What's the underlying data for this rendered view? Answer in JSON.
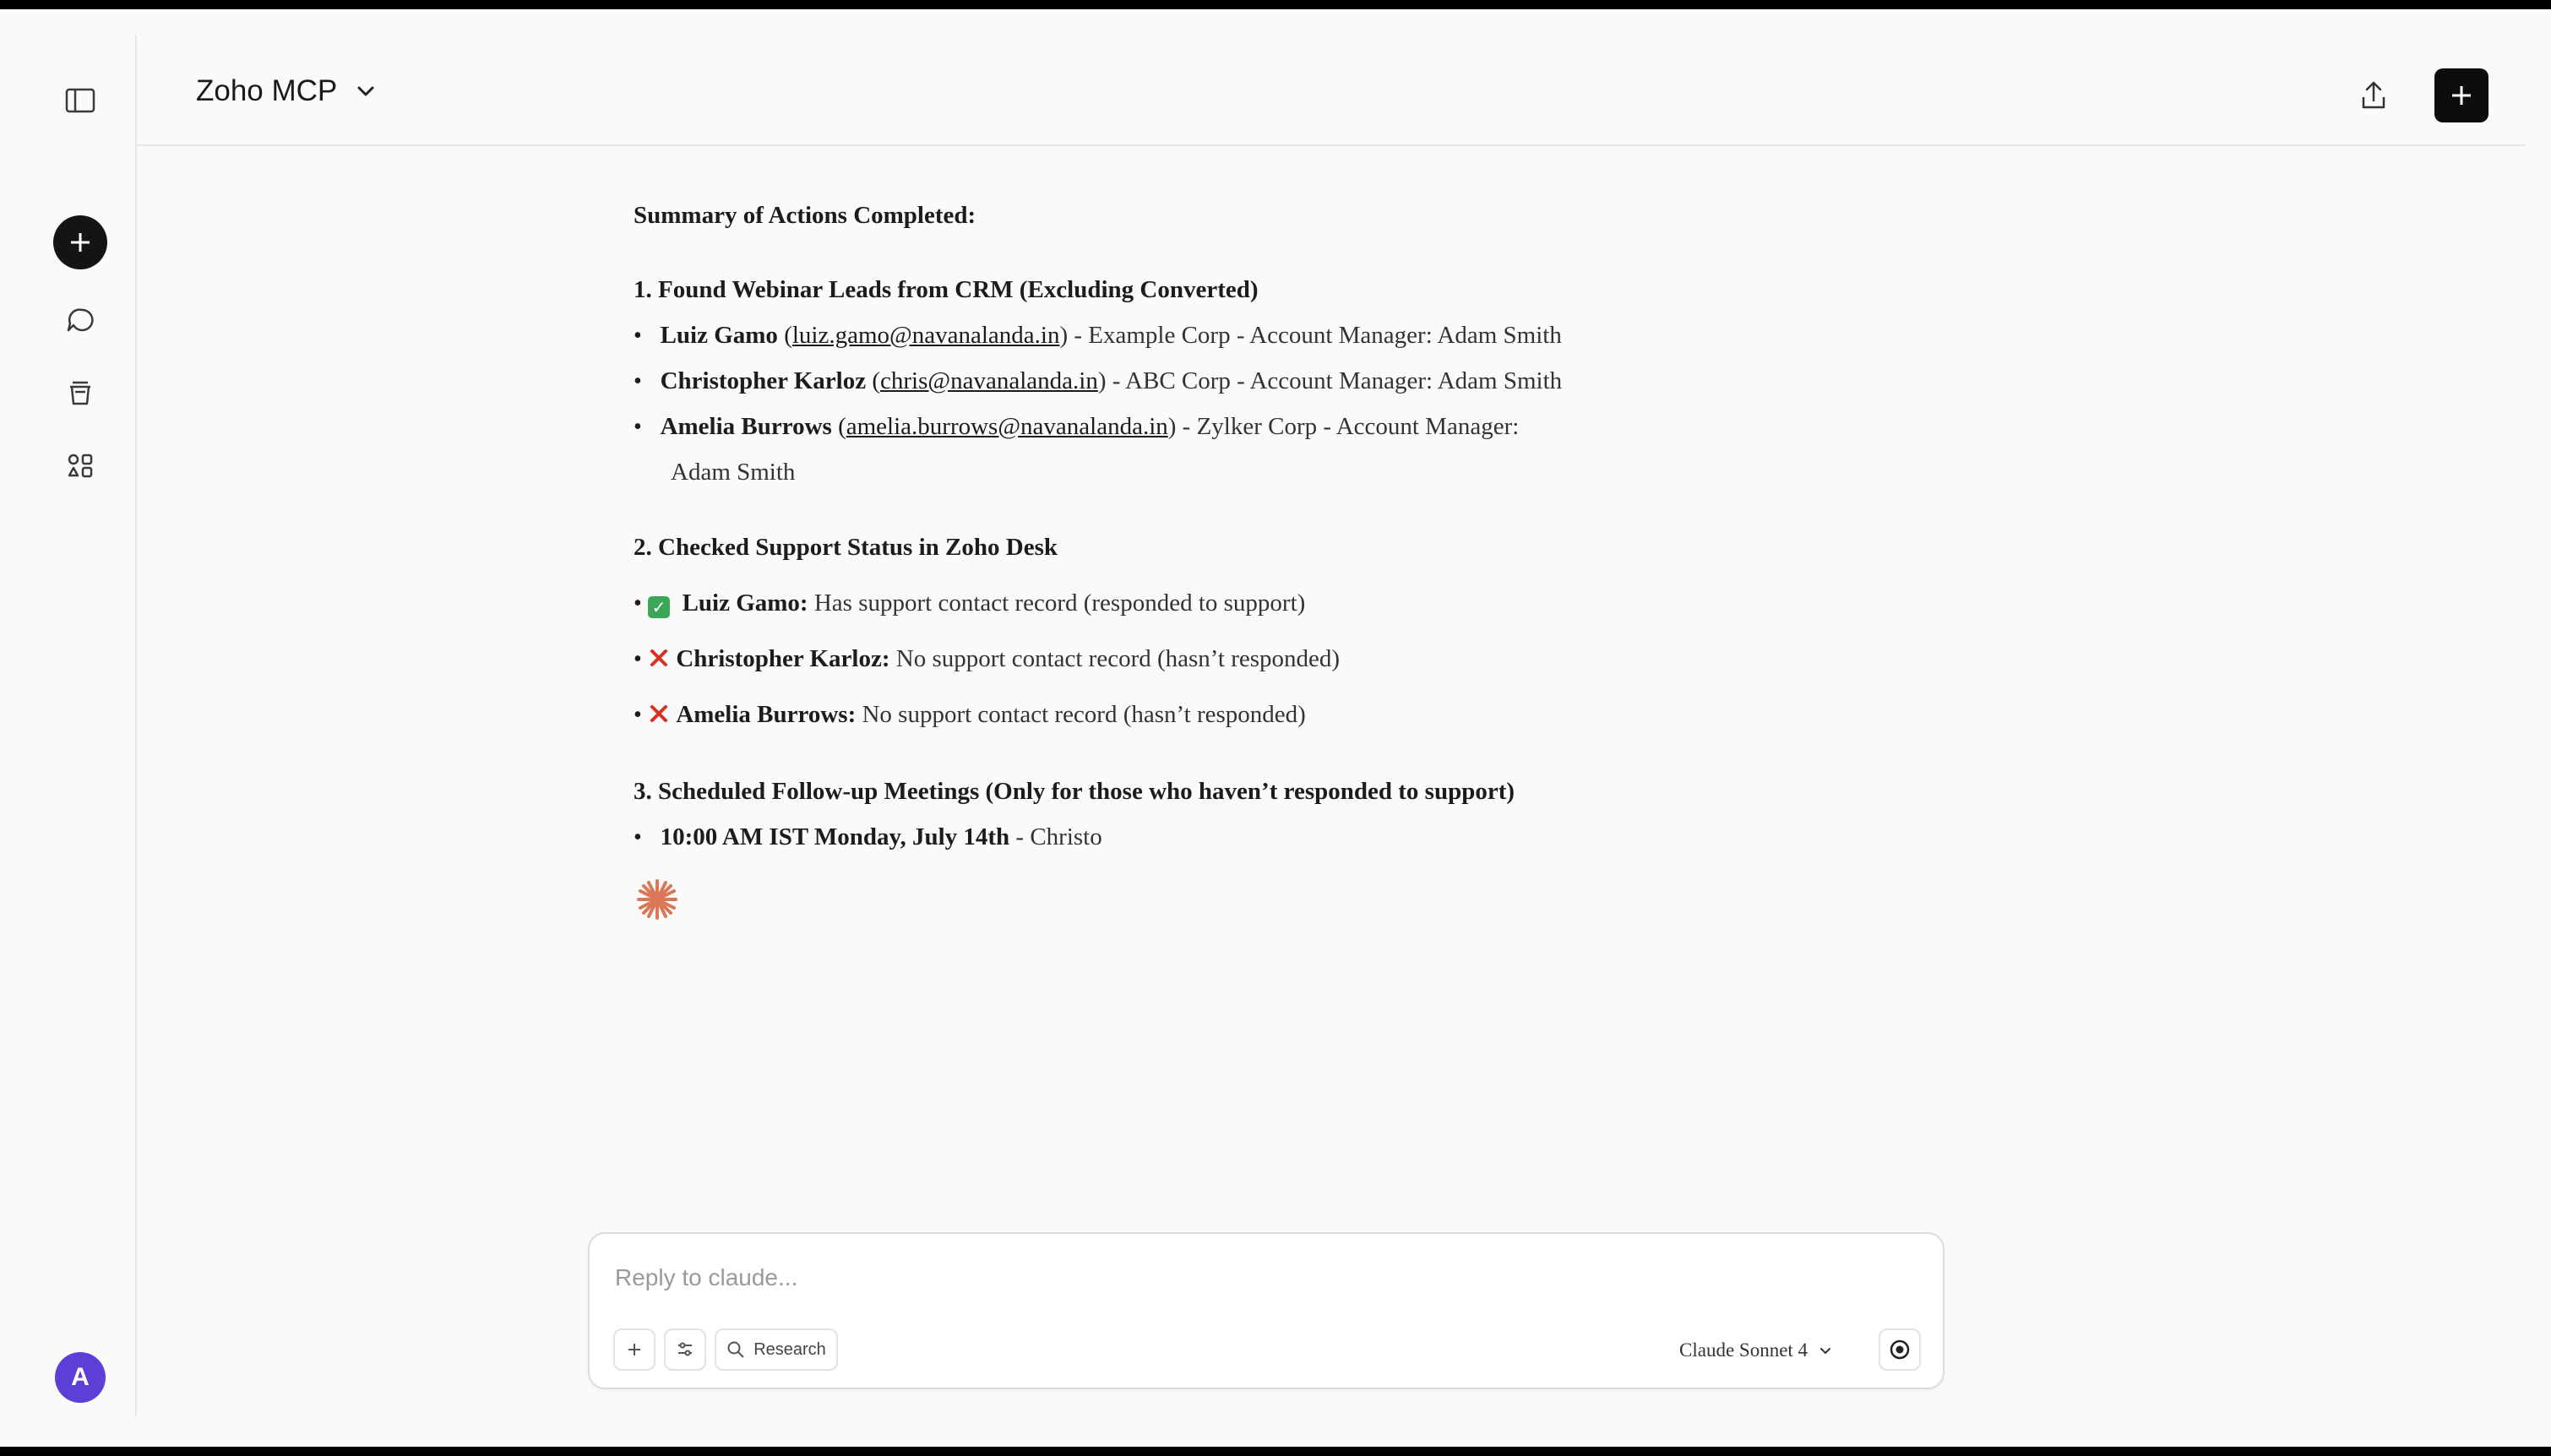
{
  "header": {
    "title": "Zoho MCP"
  },
  "sidebar": {
    "avatar_initial": "A"
  },
  "message": {
    "summary_heading": "Summary of Actions Completed:",
    "section1": {
      "heading": "1. Found Webinar Leads from CRM (Excluding Converted)",
      "leads": [
        {
          "name": "Luiz Gamo",
          "email": "luiz.gamo@navanalanda.in",
          "details": ") - Example Corp - Account Manager: Adam Smith"
        },
        {
          "name": "Christopher Karloz",
          "email": "chris@navanalanda.in",
          "details": ") - ABC Corp - Account Manager: Adam Smith"
        },
        {
          "name": "Amelia Burrows",
          "email": "amelia.burrows@navanalanda.in",
          "details": ") - Zylker Corp - Account Manager:",
          "details_wrap": "Adam Smith"
        }
      ]
    },
    "section2": {
      "heading": "2. Checked Support Status in Zoho Desk",
      "items": [
        {
          "icon": "check-icon",
          "name": "Luiz Gamo:",
          "status": "Has support contact record (responded to support)"
        },
        {
          "icon": "cross-icon",
          "name": "Christopher Karloz:",
          "status": "No support contact record (hasn’t responded)"
        },
        {
          "icon": "cross-icon",
          "name": "Amelia Burrows:",
          "status": "No support contact record (hasn’t responded)"
        }
      ]
    },
    "section3": {
      "heading": "3. Scheduled Follow-up Meetings (Only for those who haven’t responded to support)",
      "meetings": [
        {
          "time": "10:00 AM IST Monday, July 14th",
          "details": "- Christo"
        }
      ]
    }
  },
  "composer": {
    "placeholder": "Reply to claude...",
    "research_label": "Research",
    "model_label": "Claude Sonnet 4"
  },
  "colors": {
    "accent_avatar": "#5b3fd6",
    "check_green": "#3aa757",
    "cross_red": "#d93025",
    "spark_orange": "#d97757"
  }
}
